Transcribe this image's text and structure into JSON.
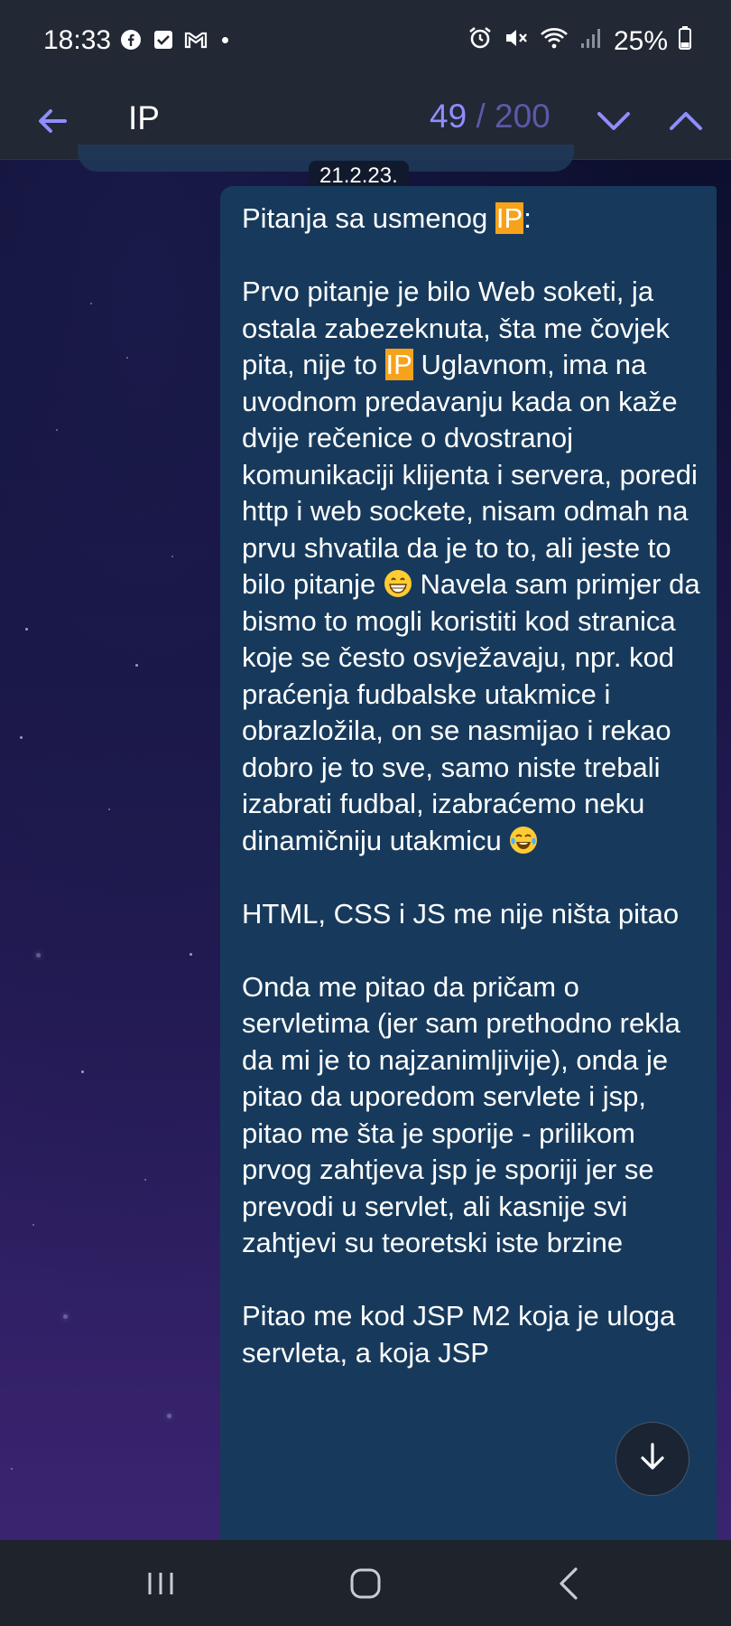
{
  "status_bar": {
    "time": "18:33",
    "notification_icons": [
      "facebook-icon",
      "check-box-icon",
      "gmail-icon",
      "dot-icon"
    ],
    "right_icons": [
      "alarm-icon",
      "mute-icon",
      "wifi-icon",
      "signal-icon"
    ],
    "battery": "25%"
  },
  "toolbar": {
    "title": "IP",
    "current": "49",
    "separator": "/",
    "total": "200",
    "back_icon": "arrow-left-icon",
    "down_icon": "chevron-down-icon",
    "up_icon": "chevron-up-icon"
  },
  "chat": {
    "date_chip": "21.2.23.",
    "message": {
      "p1_pre": "Pitanja sa usmenog ",
      "highlight": "IP",
      "p1_post": ":",
      "p2_a": "Prvo pitanje je bilo Web soketi, ja ostala zabezeknuta, šta me čovjek pita, nije to ",
      "p2_b": " Uglavnom, ima na uvodnom predavanju kada on kaže dvije rečenice o dvostranoj komunikaciji klijenta i servera, poredi http i web sockete, nisam odmah na prvu shvatila da je to to, ali jeste to bilo pitanje ",
      "p2_c": " Navela sam primjer da bismo to mogli koristiti kod stranica koje se često osvježavaju, npr. kod praćenja fudbalske utakmice i obrazložila, on se nasmijao i rekao dobro je to sve, samo niste trebali izabrati fudbal, izabraćemo neku dinamičniju utakmicu ",
      "p3": "HTML, CSS i JS me nije ništa pitao",
      "p4": "Onda me pitao da pričam o servletima (jer sam prethodno rekla da mi je to najzanimljivije), onda je pitao da uporedom servlete i jsp, pitao me šta je sporije - prilikom prvog zahtjeva jsp je sporiji jer se prevodi u servlet, ali kasnije svi zahtjevi su teoretski iste brzine",
      "p5": "Pitao me kod JSP M2 koja je uloga servleta, a koja JSP",
      "emoji_1": "grinning-face-icon",
      "emoji_2": "tears-of-joy-icon"
    },
    "fab_icon": "arrow-down-icon"
  },
  "bottom_nav": {
    "recents_icon": "recents-icon",
    "home_icon": "home-icon",
    "back_icon": "nav-back-icon"
  }
}
